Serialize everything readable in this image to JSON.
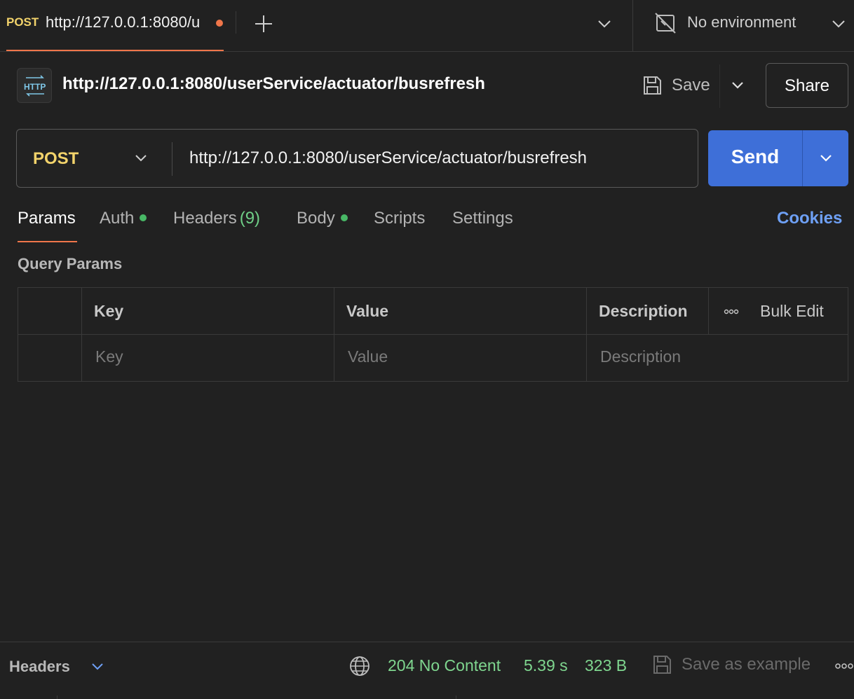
{
  "tab": {
    "method": "POST",
    "title": "http://127.0.0.1:8080/u",
    "unsaved_color": "#f0764a"
  },
  "tabbar": {
    "new_tab_icon": "plus-icon",
    "dropdown_icon": "chevron-down-icon"
  },
  "environment": {
    "icon": "no-environment-icon",
    "label": "No environment"
  },
  "request": {
    "icon": "http-icon",
    "title": "http://127.0.0.1:8080/userService/actuator/busrefresh",
    "save_label": "Save",
    "share_label": "Share"
  },
  "urlbar": {
    "method": "POST",
    "url": "http://127.0.0.1:8080/userService/actuator/busrefresh",
    "send_label": "Send",
    "send_color": "#3e6fd8"
  },
  "req_tabs": {
    "params": "Params",
    "auth": "Auth",
    "headers": "Headers",
    "headers_count": "(9)",
    "body": "Body",
    "scripts": "Scripts",
    "settings": "Settings",
    "cookies": "Cookies",
    "active": "Params"
  },
  "query_params": {
    "label": "Query Params",
    "columns": {
      "key": "Key",
      "value": "Value",
      "description": "Description"
    },
    "bulk_edit": "Bulk Edit",
    "placeholders": {
      "key": "Key",
      "value": "Value",
      "description": "Description"
    }
  },
  "response": {
    "label": "Headers",
    "status": "204 No Content",
    "time": "5.39 s",
    "size": "323 B",
    "save_example": "Save as example",
    "status_color": "#7fd68f"
  }
}
